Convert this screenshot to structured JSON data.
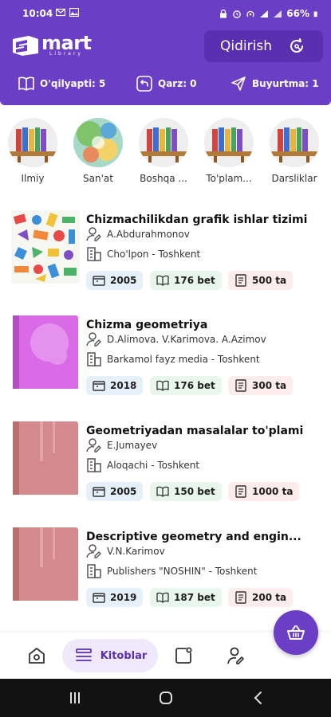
{
  "status_bar": {
    "time": "10:04",
    "battery": "66%"
  },
  "header": {
    "logo": {
      "main": "mart",
      "sub": "Library"
    },
    "search_label": "Qidirish",
    "stats": [
      {
        "icon": "book-open-icon",
        "text": "O'qilyapti: 5"
      },
      {
        "icon": "return-icon",
        "text": "Qarz: 0"
      },
      {
        "icon": "send-icon",
        "text": "Buyurtma: 1"
      }
    ]
  },
  "categories": [
    {
      "name": "Ilmiy",
      "image": "bookshelf"
    },
    {
      "name": "San'at",
      "image": "art"
    },
    {
      "name": "Boshqa ...",
      "image": "bookshelf"
    },
    {
      "name": "To'plam...",
      "image": "bookshelf"
    },
    {
      "name": "Darsliklar",
      "image": "bookshelf"
    }
  ],
  "books": [
    {
      "title": "Chizmachilikdan grafik ishlar tizimi",
      "author": "A.Abdurahmonov",
      "publisher": "Cho'lpon - Toshkent",
      "year": "2005",
      "pages": "176 bet",
      "copies": "500 ta",
      "cover": "colorful-pattern"
    },
    {
      "title": "Chizma geometriya",
      "author": "D.Alimova. V.Karimova. A.Azimov",
      "publisher": "Barkamol fayz media - Toshkent",
      "year": "2018",
      "pages": "176 bet",
      "copies": "300 ta",
      "cover": "purple-book"
    },
    {
      "title": "Geometriyadan masalalar to'plami",
      "author": "E.Jumayev",
      "publisher": "Aloqachi  - Toshkent",
      "year": "2005",
      "pages": "150 bet",
      "copies": "1000 ta",
      "cover": "pink-book"
    },
    {
      "title": "Descriptive geometry and engin...",
      "author": "V.N.Karimov",
      "publisher": "Publishers \"NOSHIN\" - Toshkent",
      "year": "2019",
      "pages": "187 bet",
      "copies": "200 ta",
      "cover": "pink-book"
    }
  ],
  "bottom_nav": {
    "active_label": "Kitoblar",
    "items": [
      "home-icon",
      "list-icon",
      "square-dot-icon",
      "user-edit-icon"
    ]
  },
  "colors": {
    "primary": "#6a3fc6",
    "year_chip": "#e6f0fb",
    "pages_chip": "#e9f6ec",
    "copies_chip": "#fdecec"
  }
}
